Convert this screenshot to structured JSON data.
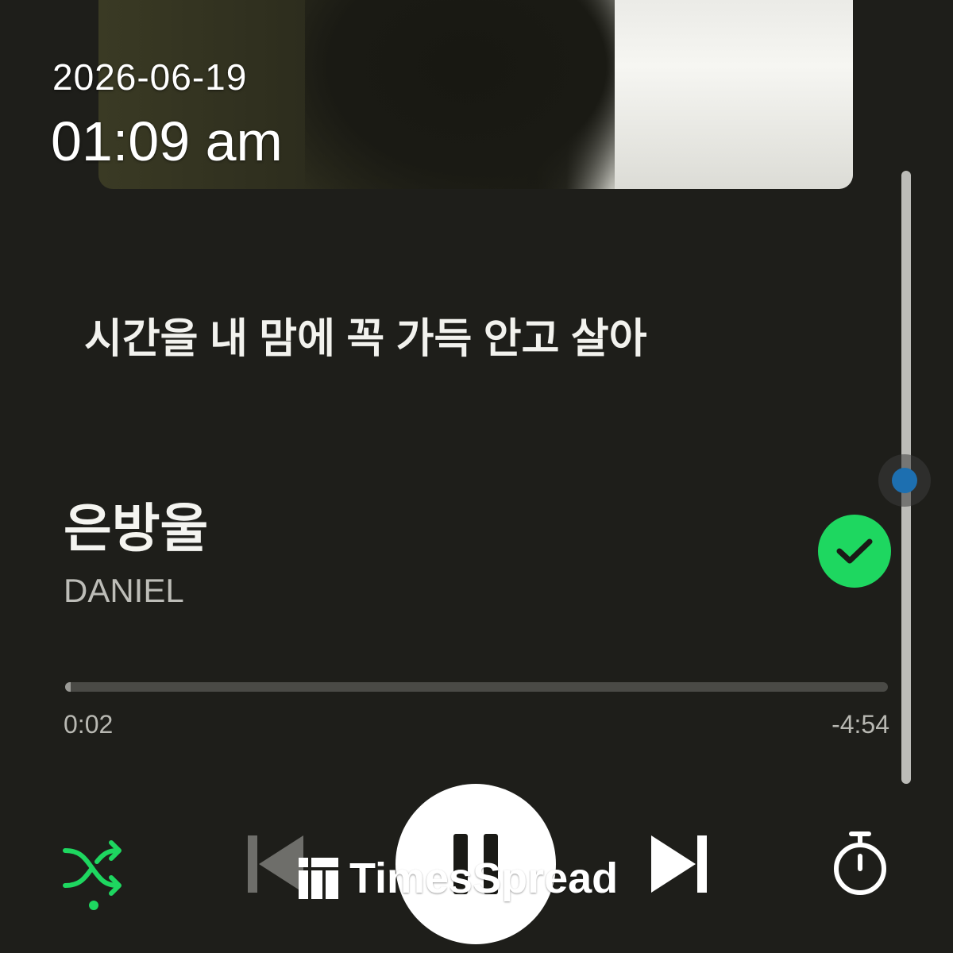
{
  "status": {
    "date": "2026-06-19",
    "time": "01:09 am"
  },
  "lyrics": {
    "current_line": "시간을 내 맘에 꼭 가득 안고 살아"
  },
  "track": {
    "title": "은방울",
    "artist": "DANIEL",
    "liked": true
  },
  "playback": {
    "elapsed": "0:02",
    "remaining": "-4:54",
    "progress_fraction": 0.007,
    "state": "playing",
    "shuffle": true
  },
  "controls": {
    "shuffle_icon": "shuffle-icon",
    "prev_icon": "skip-previous-icon",
    "play_pause_icon": "pause-icon",
    "next_icon": "skip-next-icon",
    "timer_icon": "timer-icon"
  },
  "colors": {
    "background": "#1e1e1a",
    "accent_green": "#1ed760",
    "scroll_thumb": "#1d6fb0"
  },
  "watermark": {
    "text": "TimesSpread"
  }
}
